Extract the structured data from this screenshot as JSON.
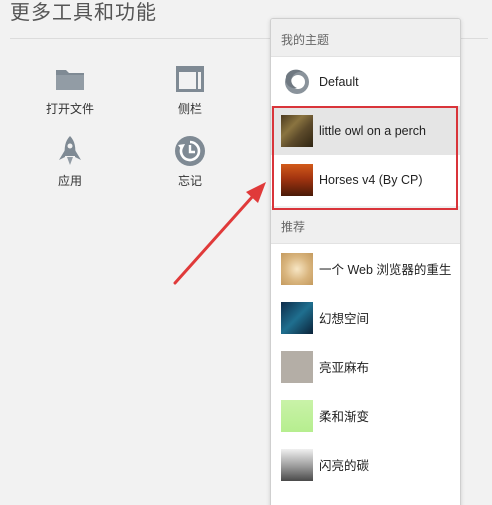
{
  "page": {
    "title": "更多工具和功能"
  },
  "tools": [
    {
      "label": "打开文件",
      "icon": "folder-icon"
    },
    {
      "label": "侧栏",
      "icon": "sidebar-icon"
    },
    {
      "label": "应用",
      "icon": "rocket-icon"
    },
    {
      "label": "忘记",
      "icon": "forget-icon"
    }
  ],
  "themes_panel": {
    "my_themes_header": "我的主题",
    "my_themes": [
      {
        "label": "Default",
        "icon": "firefox-icon"
      },
      {
        "label": "little owl on a perch",
        "icon": "owl-thumbnail"
      },
      {
        "label": "Horses v4 (By CP)",
        "icon": "horses-thumbnail"
      }
    ],
    "recommended_header": "推荐",
    "recommended": [
      {
        "label": "一个 Web 浏览器的重生",
        "icon": "rebirth-thumbnail"
      },
      {
        "label": "幻想空间",
        "icon": "fantasy-space-thumbnail"
      },
      {
        "label": "亮亚麻布",
        "icon": "linen-thumbnail"
      },
      {
        "label": "柔和渐变",
        "icon": "soft-gradient-thumbnail"
      },
      {
        "label": "闪亮的碳",
        "icon": "shiny-carbon-thumbnail"
      }
    ]
  },
  "colors": {
    "highlight": "#d9343a",
    "arrow": "#e03a3a",
    "tool_icon": "#7f8a94"
  }
}
